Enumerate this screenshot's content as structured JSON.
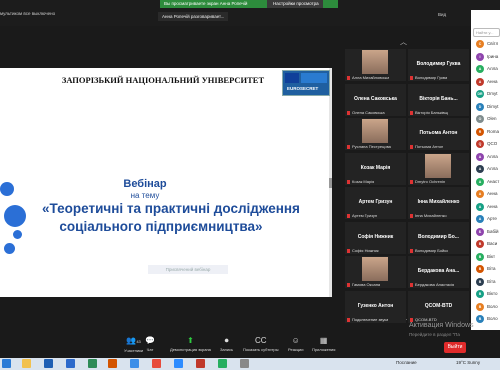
{
  "topbar": {
    "banner_green": "Вы просматриваете экран Анна Ропечій",
    "banner_view": "Настройки просмотра",
    "mute_notice": "мультиком все выключено",
    "screen_title": "Анна Ропечій разговаривает...",
    "view_label": "Вид"
  },
  "slide": {
    "university": "ЗАПОРІЗЬКИЙ НАЦІОНАЛЬНИЙ УНІВЕРСИТЕТ",
    "logo_text": "EUROSECRET",
    "webinar": "Вебінар",
    "on_topic": "на тему",
    "topic_line1": "«Теоретичні та практичні дослідження",
    "topic_line2": "соціального підприємництва»",
    "faint_caption": "Присвячений вебінар"
  },
  "gallery": {
    "tiles": [
      {
        "name": "",
        "sub": "Алла Михайловська",
        "photo": true
      },
      {
        "name": "Володимир Гуква",
        "sub": "Володимир Гуква",
        "photo": false
      },
      {
        "name": "Олена Саковська",
        "sub": "Олена Саковська",
        "photo": false
      },
      {
        "name": "Вікторія Бань...",
        "sub": "Вікторія Баньківщ",
        "photo": false
      },
      {
        "name": "",
        "sub": "Руслана Пестрецова",
        "photo": true
      },
      {
        "name": "Потьома Антон",
        "sub": "Потьома Антон",
        "photo": false
      },
      {
        "name": "Козак Марія",
        "sub": "Козак Марія",
        "photo": false
      },
      {
        "name": "",
        "sub": "Dmytro Ochrenin",
        "photo": true
      },
      {
        "name": "Артем Гризун",
        "sub": "Артем Гризун",
        "photo": false
      },
      {
        "name": "Інна Михайленко",
        "sub": "Інна Михайленко",
        "photo": false
      },
      {
        "name": "Софія Нижник",
        "sub": "Софія Нижник",
        "photo": false
      },
      {
        "name": "Володимир Бо...",
        "sub": "Володимир Бойко",
        "photo": false
      },
      {
        "name": "",
        "sub": "Гамова Оксана",
        "photo": true
      },
      {
        "name": "Бердакова Ана...",
        "sub": "Бердакова Анастасія",
        "photo": false
      },
      {
        "name": "Гузенко Антон",
        "sub": "Подключение звука",
        "photo": false
      },
      {
        "name": "QCOM-BTD",
        "sub": "QCOM-BTD",
        "photo": false
      }
    ]
  },
  "panel": {
    "search_placeholder": "Найти у...",
    "participants": [
      {
        "initials": "C",
        "name": "Світл",
        "color": "#e67e22"
      },
      {
        "initials": "I",
        "name": "Ірина",
        "color": "#8e44ad"
      },
      {
        "initials": "А",
        "name": "Алла",
        "color": "#27ae60"
      },
      {
        "initials": "А",
        "name": "Анна",
        "color": "#c0392b"
      },
      {
        "initials": "DR",
        "name": "Dmyt",
        "color": "#16a085"
      },
      {
        "initials": "D",
        "name": "Dimyt",
        "color": "#2980b9"
      },
      {
        "initials": "O",
        "name": "Olen",
        "color": "#7f8c8d"
      },
      {
        "initials": "R",
        "name": "Roma",
        "color": "#d35400"
      },
      {
        "initials": "Q",
        "name": "QCO",
        "color": "#c0392b"
      },
      {
        "initials": "А",
        "name": "Алла",
        "color": "#8e44ad"
      },
      {
        "initials": "А",
        "name": "Алла",
        "color": "#2c3e50"
      },
      {
        "initials": "А",
        "name": "Анаст",
        "color": "#27ae60"
      },
      {
        "initials": "А",
        "name": "Анна",
        "color": "#e67e22"
      },
      {
        "initials": "А",
        "name": "Анна",
        "color": "#16a085"
      },
      {
        "initials": "А",
        "name": "Арте",
        "color": "#2980b9"
      },
      {
        "initials": "Б",
        "name": "Бабій",
        "color": "#8e44ad"
      },
      {
        "initials": "В",
        "name": "Васи",
        "color": "#c0392b"
      },
      {
        "initials": "В",
        "name": "Вікт",
        "color": "#27ae60"
      },
      {
        "initials": "В",
        "name": "Віта",
        "color": "#d35400"
      },
      {
        "initials": "В",
        "name": "Віта",
        "color": "#2c3e50"
      },
      {
        "initials": "В",
        "name": "Вікто",
        "color": "#16a085"
      },
      {
        "initials": "В",
        "name": "Воло",
        "color": "#e67e22"
      },
      {
        "initials": "В",
        "name": "Воло",
        "color": "#2980b9"
      }
    ]
  },
  "toolbar": {
    "participants_count": "43",
    "participants": "Участники",
    "chat": "Чат",
    "share": "Демонстрация экрана",
    "record": "Запись",
    "subtitles": "Показать субтитры",
    "reactions": "Реакции",
    "apps": "Приложения",
    "exit": "Выйти"
  },
  "watermark": {
    "line1": "Активация Windows",
    "line2": "Перейдите в раздел \"Па"
  },
  "taskbar": {
    "notice": "Послание",
    "weather": "19°C  Sunny",
    "lang": "УКР",
    "time": "11:1"
  }
}
